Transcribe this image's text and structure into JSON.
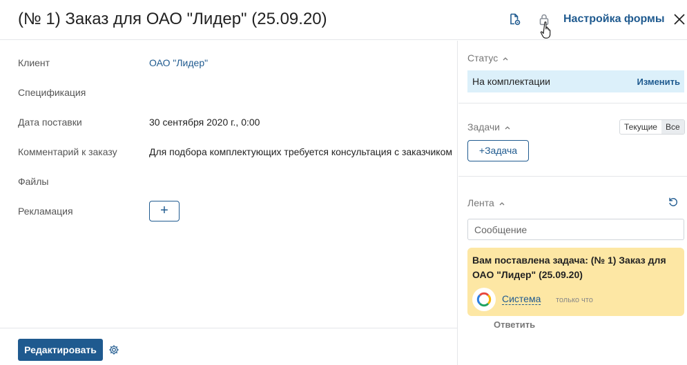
{
  "header": {
    "title": "(№ 1) Заказ для ОАО \"Лидер\" (25.09.20)",
    "form_settings_label": "Настройка формы",
    "icons": [
      "document-settings-icon",
      "lock-icon",
      "close-icon"
    ]
  },
  "fields": [
    {
      "label": "Клиент",
      "value": "ОАО \"Лидер\"",
      "is_link": true
    },
    {
      "label": "Спецификация",
      "value": ""
    },
    {
      "label": "Дата поставки",
      "value": "30 сентября 2020 г., 0:00"
    },
    {
      "label": "Комментарий к заказу",
      "value": "Для подбора комплектующих требуется консультация с заказчиком"
    },
    {
      "label": "Файлы",
      "value": ""
    },
    {
      "label": "Рекламация",
      "value": ""
    }
  ],
  "add_button_label": "+",
  "footer": {
    "edit_label": "Редактировать"
  },
  "status": {
    "title": "Статус",
    "value": "На комплектации",
    "change_label": "Изменить",
    "accent": "#dcf0fa"
  },
  "tasks": {
    "title": "Задачи",
    "filter_current": "Текущие",
    "filter_all": "Все",
    "add_task_label": "+Задача"
  },
  "feed": {
    "title": "Лента",
    "message_placeholder": "Сообщение",
    "card": {
      "text": "Вам поставлена задача: (№ 1) Заказ для ОАО \"Лидер\" (25.09.20)",
      "author": "Система",
      "time": "только что",
      "background": "#fde7a4"
    },
    "reply_label": "Ответить"
  },
  "colors": {
    "primary": "#1f5a8f",
    "border": "#e4e6e9"
  }
}
